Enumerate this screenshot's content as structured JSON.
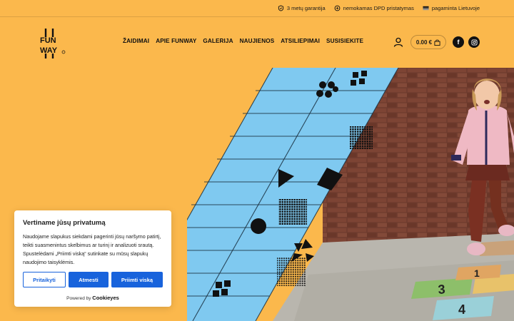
{
  "topbar": {
    "items": [
      {
        "icon": "shield-check-icon",
        "label": "3 metų garantija"
      },
      {
        "icon": "delivery-icon",
        "label": "nemokamas DPD pristatymas"
      },
      {
        "icon": "flag-icon",
        "label": "pagaminta Lietuvoje"
      }
    ]
  },
  "logo": {
    "text": "FUN WAY"
  },
  "nav": {
    "items": [
      "ŽAIDIMAI",
      "APIE FUNWAY",
      "GALERIJA",
      "NAUJIENOS",
      "ATSILIEPIMAI",
      "SUSISIEKITE"
    ]
  },
  "header": {
    "cart_total": "0.00 €",
    "social": {
      "facebook": "f",
      "instagram": "◎"
    }
  },
  "cookie": {
    "title": "Vertiname jūsų privatumą",
    "text": "Naudojame slapukus siekdami pagerinti jūsų naršymo patirtį, teikti suasmenintus skelbimus ar turinį ir analizuoti srautą. Spustelėdami „Priimti viską“ sutinkate su mūsų slapukų naudojimo taisyklėmis.",
    "customize_label": "Pritaikyti",
    "reject_label": "Atmesti",
    "accept_label": "Priimti viską",
    "powered_prefix": "Powered by",
    "powered_brand": "Cookieyes"
  },
  "colors": {
    "background": "#fbb84c",
    "cookie_accent": "#1863dc",
    "hopscotch_mat": "#7fc9f0"
  }
}
